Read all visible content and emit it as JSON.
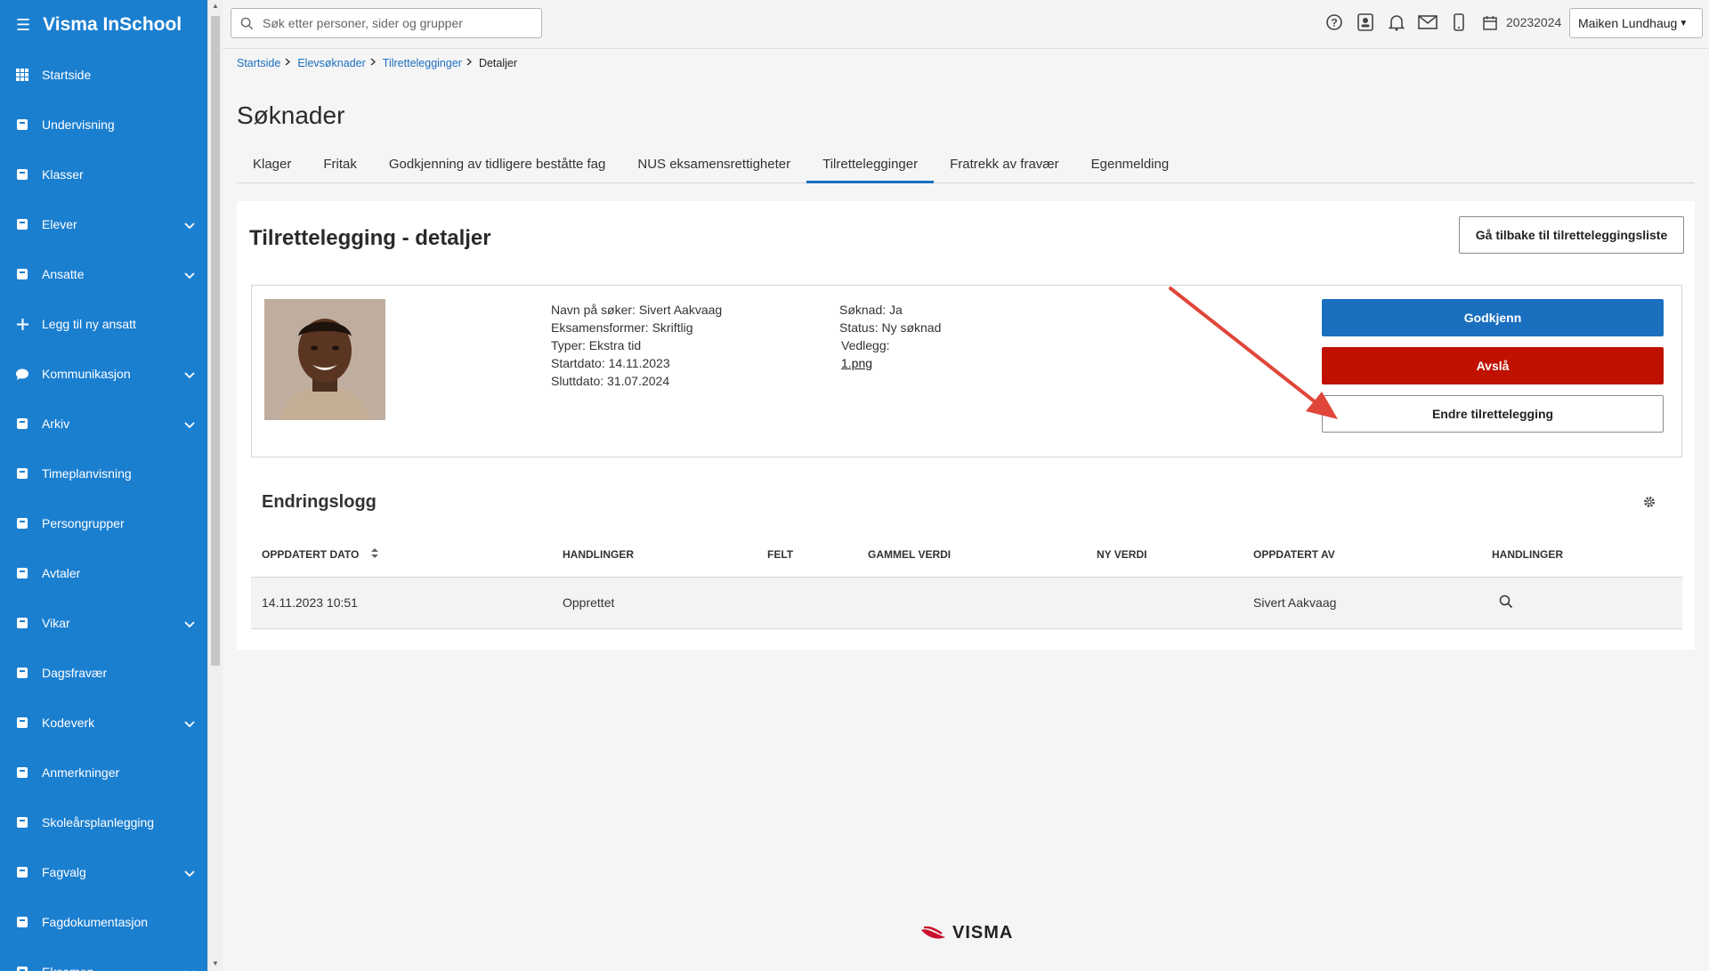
{
  "app": {
    "brand": "Visma InSchool"
  },
  "sidebar": {
    "items": [
      {
        "label": "Startside",
        "icon": "grid-icon",
        "expandable": false
      },
      {
        "label": "Undervisning",
        "icon": "book-icon",
        "expandable": false
      },
      {
        "label": "Klasser",
        "icon": "class-icon",
        "expandable": false
      },
      {
        "label": "Elever",
        "icon": "students-icon",
        "expandable": true
      },
      {
        "label": "Ansatte",
        "icon": "briefcase-icon",
        "expandable": true
      },
      {
        "label": "Legg til ny ansatt",
        "icon": "plus-icon",
        "expandable": false
      },
      {
        "label": "Kommunikasjon",
        "icon": "chat-icon",
        "expandable": true
      },
      {
        "label": "Arkiv",
        "icon": "archive-icon",
        "expandable": true
      },
      {
        "label": "Timeplanvisning",
        "icon": "calendar-icon",
        "expandable": false
      },
      {
        "label": "Persongrupper",
        "icon": "people-icon",
        "expandable": false
      },
      {
        "label": "Avtaler",
        "icon": "calendar-check-icon",
        "expandable": false
      },
      {
        "label": "Vikar",
        "icon": "sync-icon",
        "expandable": true
      },
      {
        "label": "Dagsfravær",
        "icon": "user-check-icon",
        "expandable": false
      },
      {
        "label": "Kodeverk",
        "icon": "database-icon",
        "expandable": true
      },
      {
        "label": "Anmerkninger",
        "icon": "hand-icon",
        "expandable": false
      },
      {
        "label": "Skoleårsplanlegging",
        "icon": "planner-icon",
        "expandable": false
      },
      {
        "label": "Fagvalg",
        "icon": "subject-icon",
        "expandable": true
      },
      {
        "label": "Fagdokumentasjon",
        "icon": "badge-icon",
        "expandable": false
      },
      {
        "label": "Eksamen",
        "icon": "exam-icon",
        "expandable": true
      }
    ]
  },
  "topbar": {
    "search_placeholder": "Søk etter personer, sider og grupper",
    "school_year": "20232024",
    "user_name": "Maiken Lundhaug"
  },
  "breadcrumb": [
    {
      "label": "Startside",
      "link": true
    },
    {
      "label": "Elevsøknader",
      "link": true
    },
    {
      "label": "Tilrettelegginger",
      "link": true
    },
    {
      "label": "Detaljer",
      "link": false
    }
  ],
  "page": {
    "title": "Søknader",
    "tabs": [
      {
        "label": "Klager",
        "active": false
      },
      {
        "label": "Fritak",
        "active": false
      },
      {
        "label": "Godkjenning av tidligere beståtte fag",
        "active": false
      },
      {
        "label": "NUS eksamensrettigheter",
        "active": false
      },
      {
        "label": "Tilrettelegginger",
        "active": true
      },
      {
        "label": "Fratrekk av fravær",
        "active": false
      },
      {
        "label": "Egenmelding",
        "active": false
      }
    ]
  },
  "detail": {
    "title": "Tilrettelegging - detaljer",
    "back_button": "Gå tilbake til tilretteleggingsliste",
    "left_col": [
      "Navn på søker: Sivert Aakvaag",
      "Eksamensformer: Skriftlig",
      "Typer: Ekstra tid",
      "Startdato: 14.11.2023",
      "Sluttdato: 31.07.2024"
    ],
    "right_col": {
      "soknad": "Søknad: Ja",
      "status": "Status: Ny søknad",
      "vedlegg_label": "Vedlegg:",
      "vedlegg_file": "1.png"
    },
    "approve_button": "Godkjenn",
    "reject_button": "Avslå",
    "edit_button": "Endre tilrettelegging"
  },
  "changelog": {
    "title": "Endringslogg",
    "columns": [
      "OPPDATERT DATO",
      "HANDLINGER",
      "FELT",
      "GAMMEL VERDI",
      "NY VERDI",
      "OPPDATERT AV",
      "HANDLINGER"
    ],
    "rows": [
      {
        "date": "14.11.2023 10:51",
        "action": "Opprettet",
        "field": "",
        "old": "",
        "new": "",
        "by": "Sivert Aakvaag"
      }
    ]
  },
  "footer": {
    "logo_text": "VISMA"
  },
  "colors": {
    "sidebar": "#1b7fd0",
    "primary": "#1b6fbf",
    "danger": "#c01000",
    "arrow": "#e0463a"
  }
}
